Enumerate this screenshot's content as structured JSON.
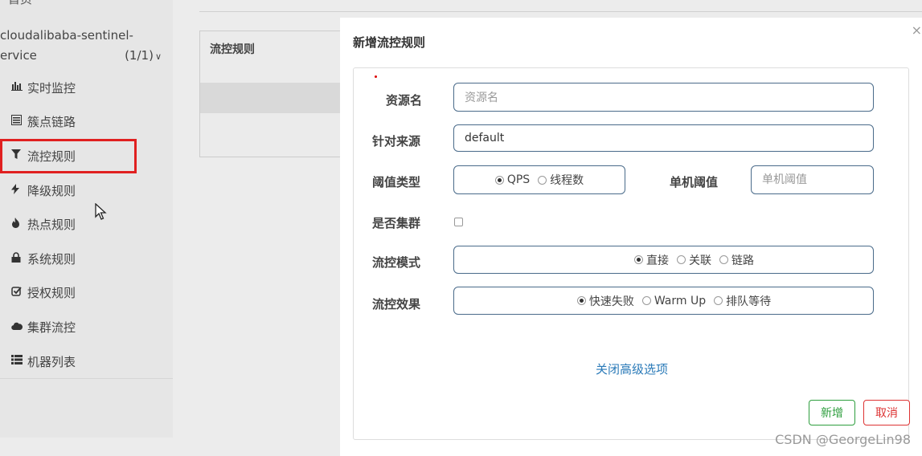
{
  "sidebar": {
    "top_title": "首页",
    "service_line1": "cloudalibaba-sentinel-",
    "service_line2": "ervice",
    "service_count": "(1/1)",
    "items": [
      {
        "label": "实时监控",
        "icon": "bar-chart-icon"
      },
      {
        "label": "簇点链路",
        "icon": "list-icon"
      },
      {
        "label": "流控规则",
        "icon": "filter-icon"
      },
      {
        "label": "降级规则",
        "icon": "bolt-icon"
      },
      {
        "label": "热点规则",
        "icon": "fire-icon"
      },
      {
        "label": "系统规则",
        "icon": "lock-icon"
      },
      {
        "label": "授权规则",
        "icon": "check-square-icon"
      },
      {
        "label": "集群流控",
        "icon": "cloud-icon"
      },
      {
        "label": "机器列表",
        "icon": "th-list-icon"
      }
    ]
  },
  "background_panel": {
    "title": "流控规则"
  },
  "modal": {
    "title": "新增流控规则",
    "close": "×",
    "resource": {
      "label": "资源名",
      "placeholder": "资源名",
      "value": ""
    },
    "source": {
      "label": "针对来源",
      "value": "default"
    },
    "threshold_type": {
      "label": "阈值类型",
      "options": [
        "QPS",
        "线程数"
      ],
      "selected": "QPS"
    },
    "single_threshold": {
      "label": "单机阈值",
      "placeholder": "单机阈值"
    },
    "cluster": {
      "label": "是否集群",
      "checked": false
    },
    "flow_mode": {
      "label": "流控模式",
      "options": [
        "直接",
        "关联",
        "链路"
      ],
      "selected": "直接"
    },
    "flow_effect": {
      "label": "流控效果",
      "options": [
        "快速失败",
        "Warm Up",
        "排队等待"
      ],
      "selected": "快速失败"
    },
    "advanced_link": "关闭高级选项",
    "ok_button": "新增",
    "cancel_button": "取消"
  },
  "watermark": "CSDN @GeorgeLin98",
  "colors": {
    "active_border": "#e02020",
    "link": "#2a7ab8",
    "ok": "#2e9e3e",
    "cancel": "#dd3333"
  }
}
